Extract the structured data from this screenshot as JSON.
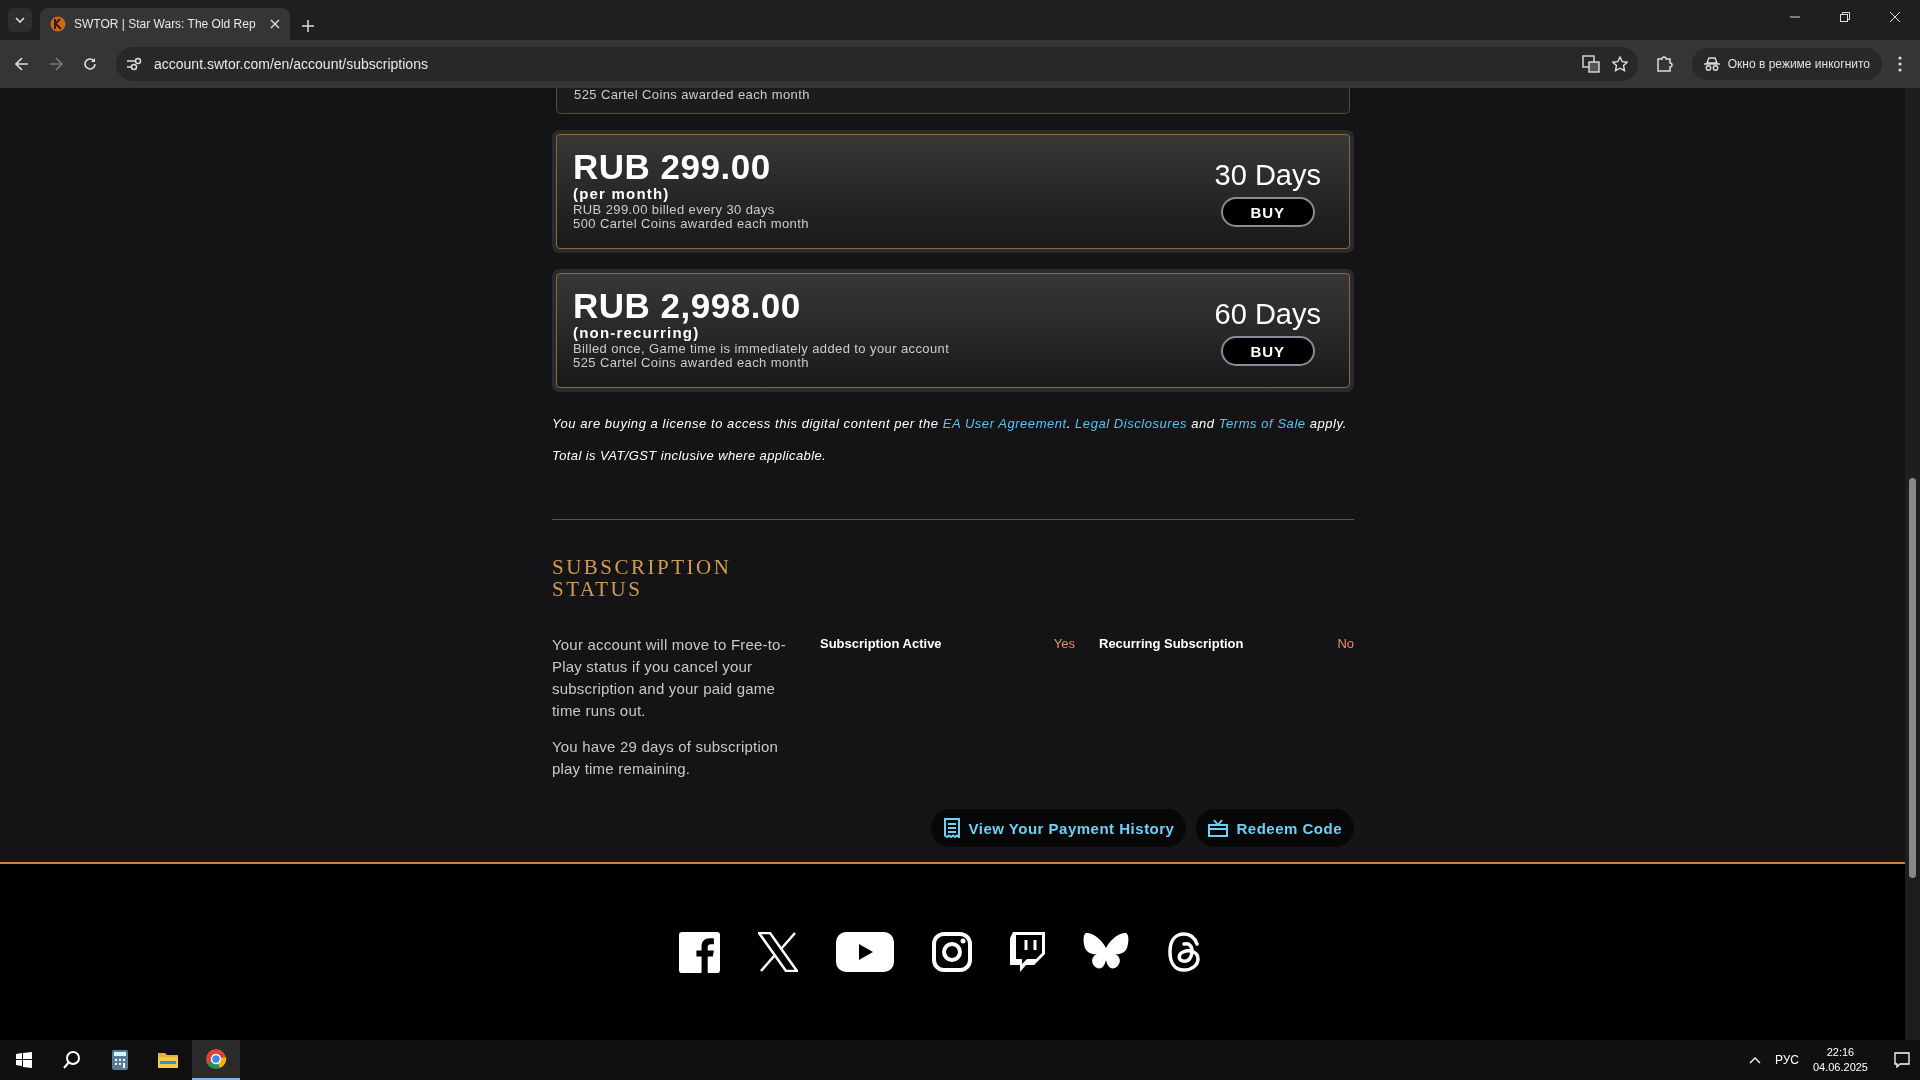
{
  "browser": {
    "tab_title": "SWTOR | Star Wars: The Old Rep",
    "url": "account.swtor.com/en/account/subscriptions",
    "incognito_label": "Окно в режиме инкогнито"
  },
  "partial_plan": {
    "detail": "525 Cartel Coins awarded each month"
  },
  "plans": [
    {
      "price": "RUB 299.00",
      "term": "(per month)",
      "details": [
        "RUB 299.00 billed every 30 days",
        "500 Cartel Coins awarded each month"
      ],
      "duration": "30 Days",
      "button": "BUY"
    },
    {
      "price": "RUB 2,998.00",
      "term": "(non-recurring)",
      "details": [
        "Billed once, Game time is immediately added to your account",
        "525 Cartel Coins awarded each month"
      ],
      "duration": "60 Days",
      "button": "BUY"
    }
  ],
  "legal": [
    {
      "kind": "text",
      "text": "You are buying a license to access this digital content per the "
    },
    {
      "kind": "link",
      "text": "EA User Agreement"
    },
    {
      "kind": "text",
      "text": ". "
    },
    {
      "kind": "link",
      "text": "Legal Disclosures"
    },
    {
      "kind": "text",
      "text": " and "
    },
    {
      "kind": "link",
      "text": "Terms of Sale"
    },
    {
      "kind": "text",
      "text": " apply."
    }
  ],
  "vat_note": "Total is VAT/GST inclusive where applicable.",
  "status": {
    "heading": "SUBSCRIPTION STATUS",
    "paragraphs": [
      "Your account will move to Free-to-Play status if you cancel your subscription and your paid game time runs out.",
      "You have 29 days of subscription play time remaining."
    ],
    "fields": [
      {
        "label": "Subscription Active",
        "value": "Yes"
      },
      {
        "label": "Recurring Subscription",
        "value": "No"
      }
    ]
  },
  "actions": [
    {
      "kind": "history",
      "label": "View Your Payment History"
    },
    {
      "kind": "redeem",
      "label": "Redeem Code"
    }
  ],
  "taskbar": {
    "language": "РУС",
    "time": "22:16",
    "date": "04.06.2025"
  }
}
